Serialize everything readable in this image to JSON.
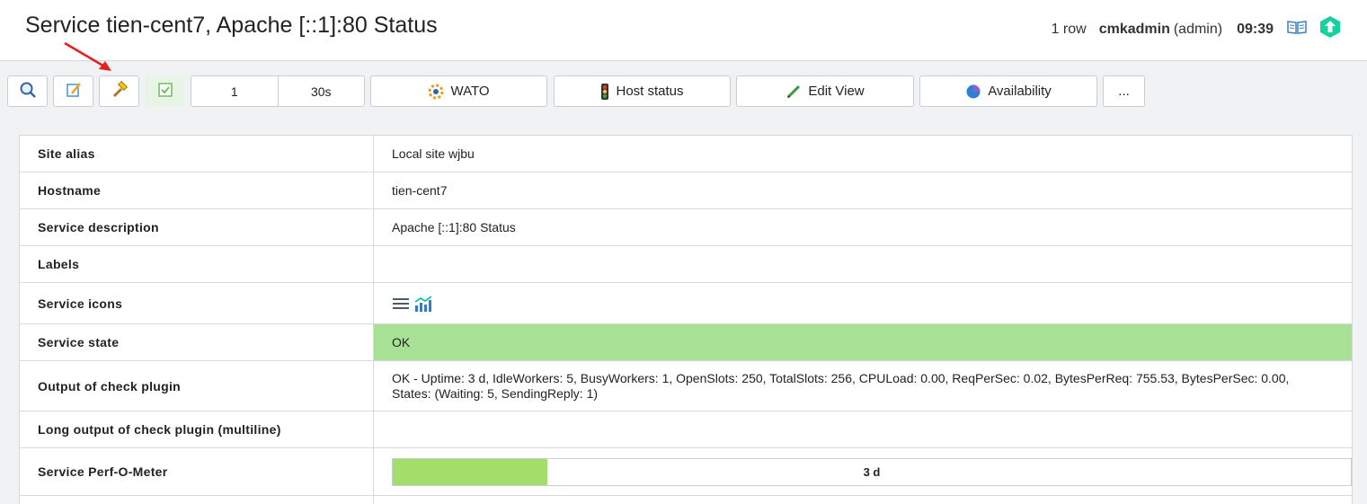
{
  "header": {
    "title": "Service tien-cent7, Apache [::1]:80 Status",
    "row_count": "1 row",
    "username": "cmkadmin",
    "role": "(admin)",
    "clock": "09:39"
  },
  "toolbar": {
    "refresh_count": "1",
    "refresh_interval": "30s",
    "wato_label": "WATO",
    "host_status_label": "Host status",
    "edit_view_label": "Edit View",
    "availability_label": "Availability",
    "more_label": "..."
  },
  "table": {
    "rows": [
      {
        "label": "Site alias",
        "value": "Local site wjbu"
      },
      {
        "label": "Hostname",
        "value": "tien-cent7"
      },
      {
        "label": "Service description",
        "value": "Apache [::1]:80 Status"
      },
      {
        "label": "Labels",
        "value": ""
      },
      {
        "label": "Service icons",
        "value": ""
      },
      {
        "label": "Service state",
        "value": "OK"
      },
      {
        "label": "Output of check plugin",
        "value": "OK - Uptime: 3 d, IdleWorkers: 5, BusyWorkers: 1, OpenSlots: 250, TotalSlots: 256, CPULoad: 0.00, ReqPerSec: 0.02, BytesPerReq: 755.53, BytesPerSec: 0.00, States: (Waiting: 5, SendingReply: 1)"
      },
      {
        "label": "Long output of check plugin (multiline)",
        "value": ""
      },
      {
        "label": "Service Perf-O-Meter",
        "value": "3 d"
      }
    ],
    "state_color": "#a8e196",
    "perf_fill_fraction": 0.161,
    "perf_fill_color": "#a3de6a"
  },
  "icons": {
    "search": "search-icon",
    "edit": "edit-icon",
    "hammer": "hammer-icon",
    "checkbox": "checkbox-icon",
    "wato": "gear-icon",
    "host_status": "traffic-light-icon",
    "edit_view": "pencil-icon",
    "availability": "pie-icon",
    "help": "book-icon",
    "logo": "checkmk-logo-icon"
  }
}
